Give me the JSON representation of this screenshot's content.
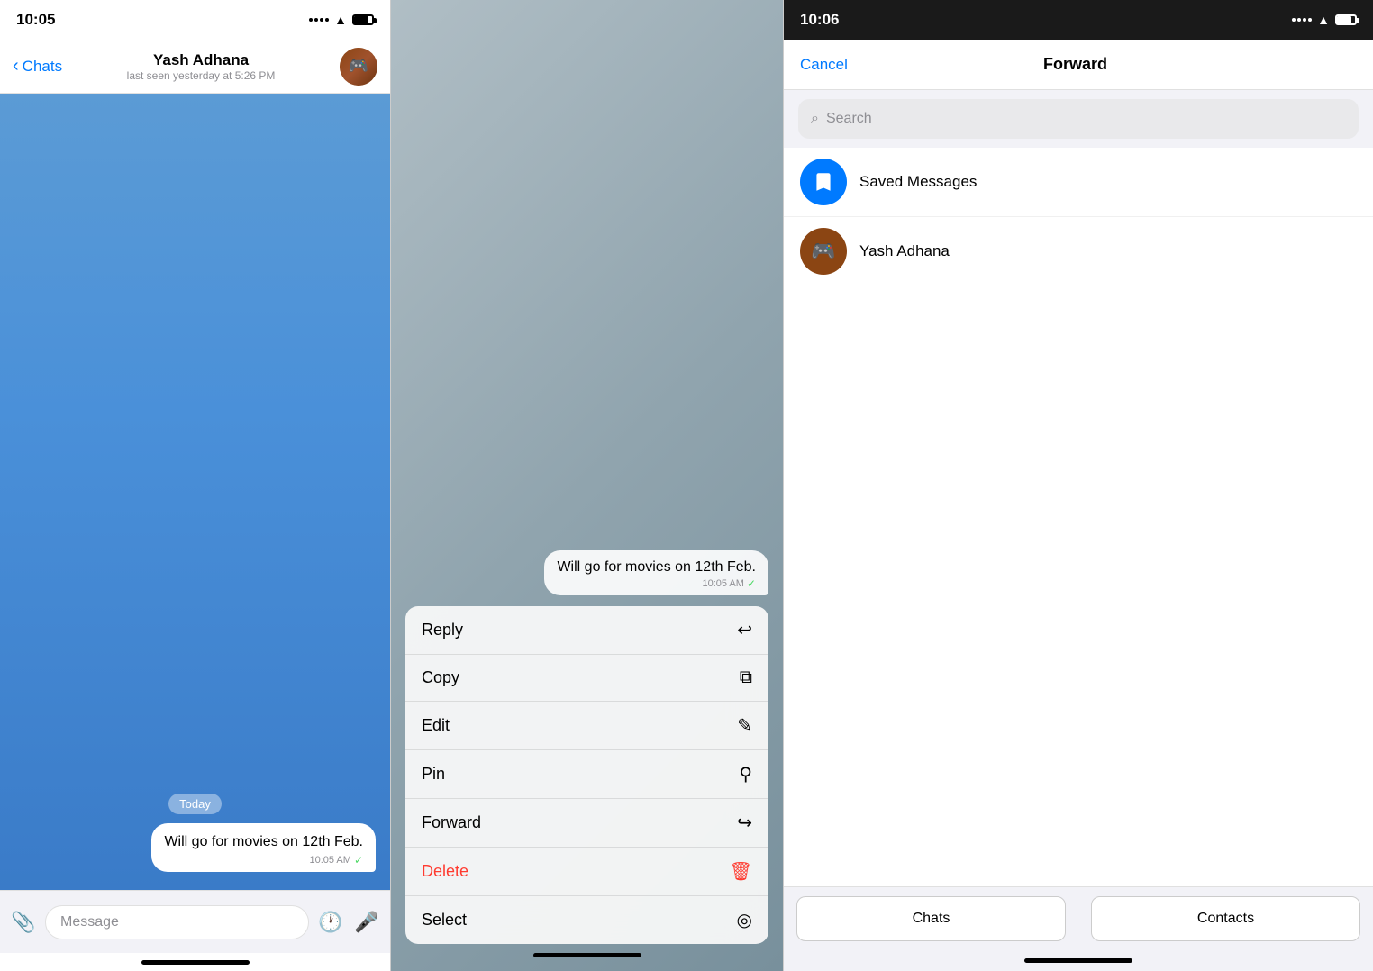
{
  "panel1": {
    "status_time": "10:05",
    "nav_title": "Yash Adhana",
    "nav_subtitle": "last seen yesterday at 5:26 PM",
    "nav_back_label": "Chats",
    "date_badge": "Today",
    "message_text": "Will go for movies on 12th Feb.",
    "message_time": "10:05 AM",
    "input_placeholder": "Message"
  },
  "panel2": {
    "message_text": "Will go for movies on 12th Feb.",
    "message_time": "10:05 AM",
    "menu_items": [
      {
        "label": "Reply",
        "icon": "↩",
        "color": "normal"
      },
      {
        "label": "Copy",
        "icon": "⧉",
        "color": "normal"
      },
      {
        "label": "Edit",
        "icon": "✎",
        "color": "normal"
      },
      {
        "label": "Pin",
        "icon": "⚲",
        "color": "normal"
      },
      {
        "label": "Forward",
        "icon": "↪",
        "color": "normal"
      },
      {
        "label": "Delete",
        "icon": "🗑",
        "color": "delete"
      },
      {
        "label": "Select",
        "icon": "◎",
        "color": "normal"
      }
    ]
  },
  "panel3": {
    "status_time": "10:06",
    "nav_cancel": "Cancel",
    "nav_title": "Forward",
    "search_placeholder": "Search",
    "contacts": [
      {
        "name": "Saved Messages",
        "type": "saved"
      },
      {
        "name": "Yash Adhana",
        "type": "yash"
      }
    ],
    "tab_chats": "Chats",
    "tab_contacts": "Contacts"
  }
}
